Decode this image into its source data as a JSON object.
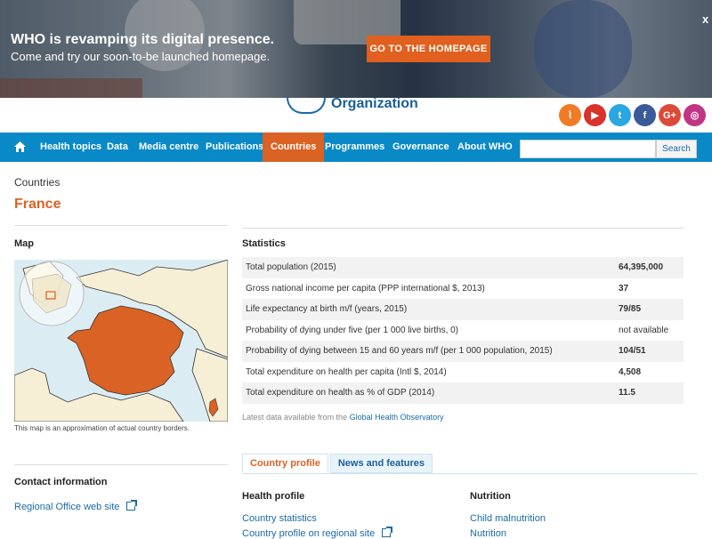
{
  "banner": {
    "title": "WHO is revamping its digital presence.",
    "subtitle": "Come and try our soon-to-be launched homepage.",
    "button": "GO TO THE HOMEPAGE",
    "close": "x"
  },
  "header": {
    "logo_text": "Organization",
    "social": [
      {
        "icon": "rss-icon",
        "glyph": "⌇",
        "color": "#f07b26"
      },
      {
        "icon": "youtube-icon",
        "glyph": "▶",
        "color": "#d9322b"
      },
      {
        "icon": "twitter-icon",
        "glyph": "t",
        "color": "#2aa6e0"
      },
      {
        "icon": "facebook-icon",
        "glyph": "f",
        "color": "#3b5a9a"
      },
      {
        "icon": "google-plus-icon",
        "glyph": "G+",
        "color": "#dc4a38"
      },
      {
        "icon": "instagram-icon",
        "glyph": "◎",
        "color": "#c13584"
      }
    ]
  },
  "nav": {
    "items": [
      "Health topics",
      "Data",
      "Media centre",
      "Publications",
      "Countries",
      "Programmes",
      "Governance",
      "About WHO"
    ],
    "active": "Countries",
    "search_button": "Search",
    "search_placeholder": ""
  },
  "page": {
    "breadcrumb": "Countries",
    "title": "France"
  },
  "map": {
    "label": "Map",
    "note": "This map is an approximation of actual country borders."
  },
  "statistics": {
    "label": "Statistics",
    "rows": [
      {
        "label": "Total population (2015)",
        "value": "64,395,000",
        "bold": true
      },
      {
        "label": "Gross national income per capita (PPP international $, 2013)",
        "value": "37",
        "bold": true
      },
      {
        "label": "Life expectancy at birth m/f (years, 2015)",
        "value": "79/85",
        "bold": true
      },
      {
        "label": "Probability of dying under five (per 1 000 live births, 0)",
        "value": "not available",
        "bold": false
      },
      {
        "label": "Probability of dying between 15 and 60 years m/f (per 1 000 population, 2015)",
        "value": "104/51",
        "bold": true
      },
      {
        "label": "Total expenditure on health per capita (Intl $, 2014)",
        "value": "4,508",
        "bold": true
      },
      {
        "label": "Total expenditure on health as % of GDP (2014)",
        "value": "11.5",
        "bold": true
      }
    ],
    "source_prefix": "Latest data available from the ",
    "source_link": "Global Health Observatory"
  },
  "tabs": {
    "country_profile": "Country profile",
    "news": "News and features"
  },
  "contact": {
    "title": "Contact information",
    "link": "Regional Office web site"
  },
  "profile": {
    "health_title": "Health profile",
    "health_links": [
      "Country statistics",
      "Country profile on regional site"
    ],
    "nutrition_title": "Nutrition",
    "nutrition_links": [
      "Child malnutrition",
      "Nutrition"
    ]
  },
  "colors": {
    "accent": "#d96224",
    "nav": "#0a89c7",
    "link": "#1a6aa5"
  }
}
